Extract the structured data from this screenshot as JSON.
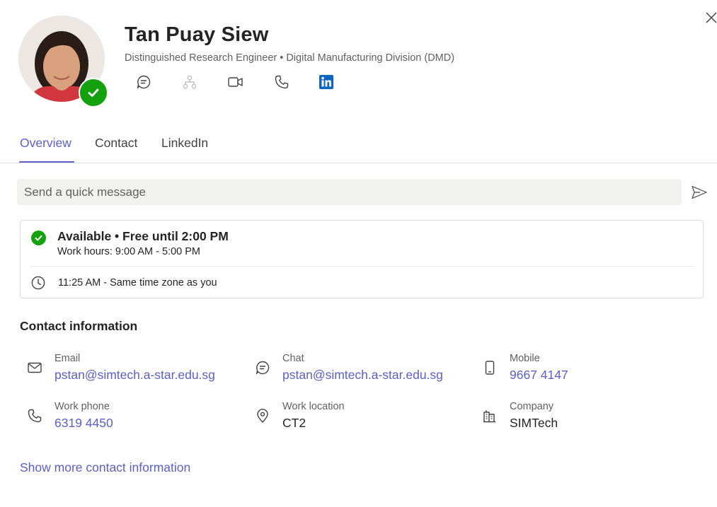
{
  "profile": {
    "name": "Tan Puay Siew",
    "subtitle": "Distinguished Research Engineer • Digital Manufacturing Division (DMD)",
    "presence": "available",
    "actions": [
      "chat-icon",
      "org-chart-icon",
      "video-call-icon",
      "phone-icon",
      "linkedin-icon"
    ]
  },
  "tabs": [
    {
      "label": "Overview",
      "active": true
    },
    {
      "label": "Contact",
      "active": false
    },
    {
      "label": "LinkedIn",
      "active": false
    }
  ],
  "quick_message": {
    "placeholder": "Send a quick message"
  },
  "status": {
    "title": "Available • Free until 2:00 PM",
    "hours": "Work hours: 9:00 AM - 5:00 PM",
    "time": "11:25 AM - Same time zone as you"
  },
  "contact": {
    "title": "Contact information",
    "email": {
      "label": "Email",
      "value": "pstan@simtech.a-star.edu.sg"
    },
    "chat": {
      "label": "Chat",
      "value": "pstan@simtech.a-star.edu.sg"
    },
    "mobile": {
      "label": "Mobile",
      "value": "9667 4147"
    },
    "work_phone": {
      "label": "Work phone",
      "value": "6319 4450"
    },
    "work_location": {
      "label": "Work location",
      "value": "CT2"
    },
    "company": {
      "label": "Company",
      "value": "SIMTech"
    }
  },
  "show_more": "Show more contact information",
  "colors": {
    "accent": "#5b5fc7",
    "available": "#13a10e",
    "linkedin": "#0a66c2"
  }
}
